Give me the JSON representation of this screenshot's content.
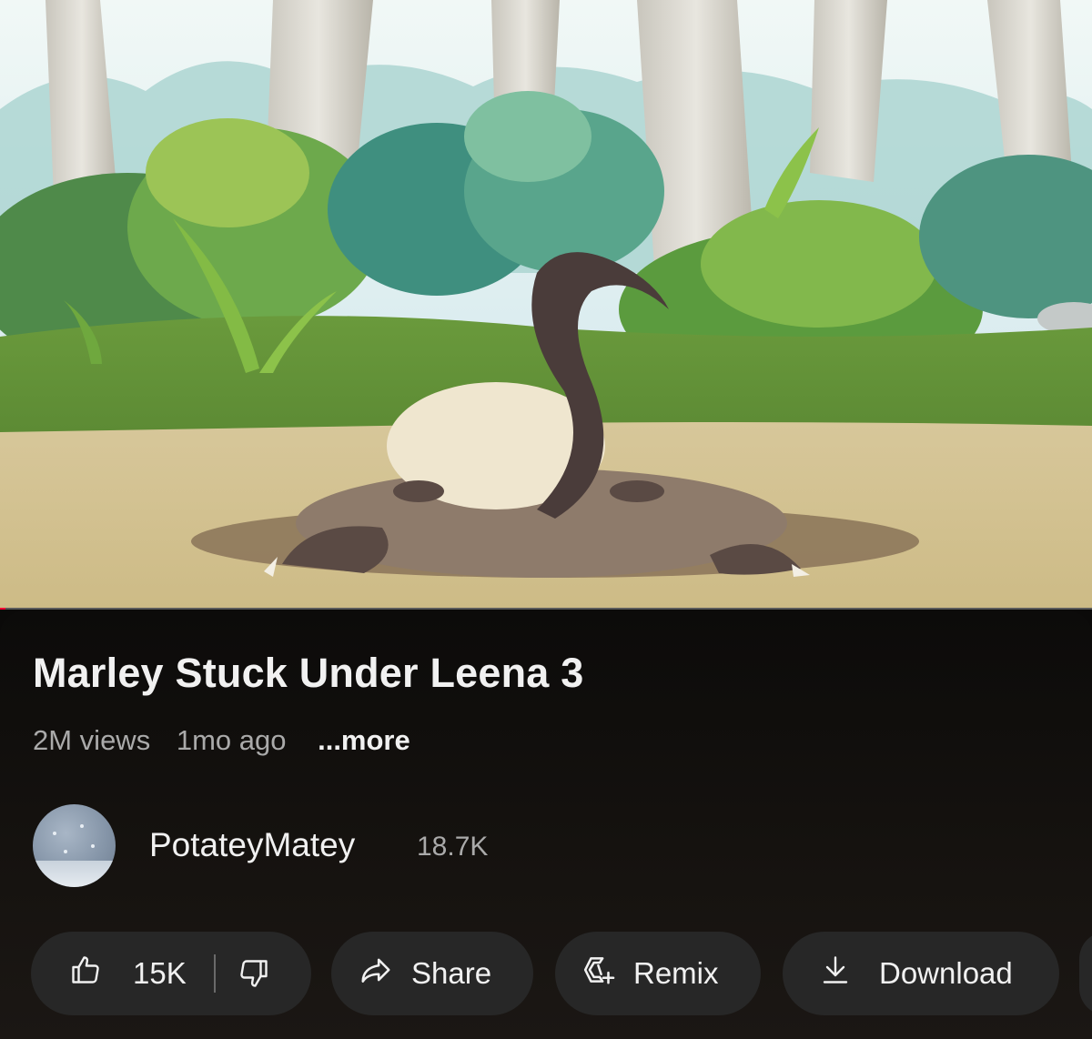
{
  "video": {
    "title": "Marley Stuck Under Leena 3",
    "views": "2M views",
    "age": "1mo ago",
    "more_label": "...more",
    "progress": 0.005
  },
  "channel": {
    "name": "PotateyMatey",
    "subscribers": "18.7K"
  },
  "actions": {
    "likes": "15K",
    "share_label": "Share",
    "remix_label": "Remix",
    "download_label": "Download"
  },
  "icons": {
    "like": "thumbs-up-icon",
    "dislike": "thumbs-down-icon",
    "share": "share-arrow-icon",
    "remix": "remix-icon",
    "download": "download-icon"
  },
  "colors": {
    "background": "#0b0a09",
    "pill": "#272727",
    "text_primary": "#f1f1f1",
    "text_secondary": "#aaaaaa",
    "progress": "#ff0033"
  }
}
